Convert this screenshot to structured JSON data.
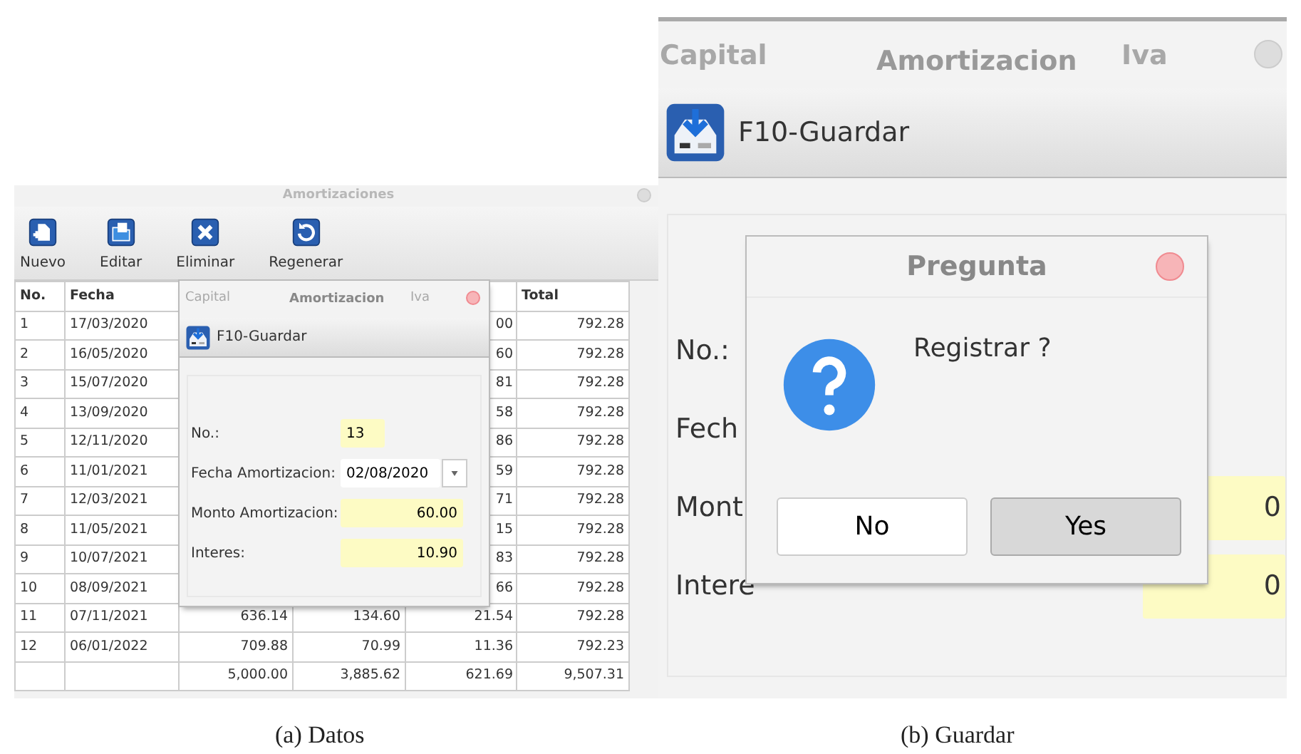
{
  "panel_a": {
    "window": {
      "title": "Amortizaciones"
    },
    "toolbar": [
      {
        "label": "Nuevo",
        "kind": "new"
      },
      {
        "label": "Editar",
        "kind": "edit"
      },
      {
        "label": "Eliminar",
        "kind": "delete"
      },
      {
        "label": "Regenerar",
        "kind": "refresh"
      }
    ],
    "table": {
      "header": {
        "no": "No.",
        "fecha": "Fecha",
        "total": "Total"
      },
      "rows": [
        {
          "no": "1",
          "fecha": "17/03/2020",
          "iva": "00",
          "total": "792.28"
        },
        {
          "no": "2",
          "fecha": "16/05/2020",
          "iva": "60",
          "total": "792.28"
        },
        {
          "no": "3",
          "fecha": "15/07/2020",
          "iva": "81",
          "total": "792.28"
        },
        {
          "no": "4",
          "fecha": "13/09/2020",
          "iva": "58",
          "total": "792.28"
        },
        {
          "no": "5",
          "fecha": "12/11/2020",
          "iva": "86",
          "total": "792.28"
        },
        {
          "no": "6",
          "fecha": "11/01/2021",
          "iva": "59",
          "total": "792.28"
        },
        {
          "no": "7",
          "fecha": "12/03/2021",
          "iva": "71",
          "total": "792.28"
        },
        {
          "no": "8",
          "fecha": "11/05/2021",
          "iva": "15",
          "total": "792.28"
        },
        {
          "no": "9",
          "fecha": "10/07/2021",
          "iva": "83",
          "total": "792.28"
        },
        {
          "no": "10",
          "fecha": "08/09/2021",
          "iva": "66",
          "total": "792.28"
        },
        {
          "no": "11",
          "fecha": "07/11/2021",
          "capital": "636.14",
          "amortizacion": "134.60",
          "iva": "21.54",
          "total": "792.28"
        },
        {
          "no": "12",
          "fecha": "06/01/2022",
          "capital": "709.88",
          "amortizacion": "70.99",
          "iva": "11.36",
          "total": "792.23"
        },
        {
          "capital": "5,000.00",
          "amortizacion": "3,885.62",
          "iva": "621.69",
          "total": "9,507.31"
        }
      ]
    },
    "dialog": {
      "title": "Amortizacion",
      "ghost_headers": [
        "Capital",
        "Iva"
      ],
      "save_button": "F10-Guardar",
      "fields": [
        {
          "label": "No.:",
          "value": "13",
          "kind": "short"
        },
        {
          "label": "Fecha Amortizacion:",
          "value": "02/08/2020",
          "kind": "date"
        },
        {
          "label": "Monto Amortizacion:",
          "value": "60.00",
          "kind": "number"
        },
        {
          "label": "Interes:",
          "value": "10.90",
          "kind": "number"
        }
      ]
    },
    "caption": "(a) Datos"
  },
  "panel_b": {
    "window": {
      "title": "Amortizacion",
      "ghost_headers": [
        "Capital",
        "Iva"
      ]
    },
    "save_button": "F10-Guardar",
    "form_rows": [
      {
        "label": "No.:"
      },
      {
        "label": "Fech"
      },
      {
        "label": "Mont",
        "field_tail": "0"
      },
      {
        "label": "Intere",
        "field_tail": "0"
      }
    ],
    "dialog": {
      "title": "Pregunta",
      "message": "Registrar ?",
      "buttons": [
        {
          "label": "No",
          "selected": false
        },
        {
          "label": "Yes",
          "selected": true
        }
      ]
    },
    "caption": "(b) Guardar"
  }
}
